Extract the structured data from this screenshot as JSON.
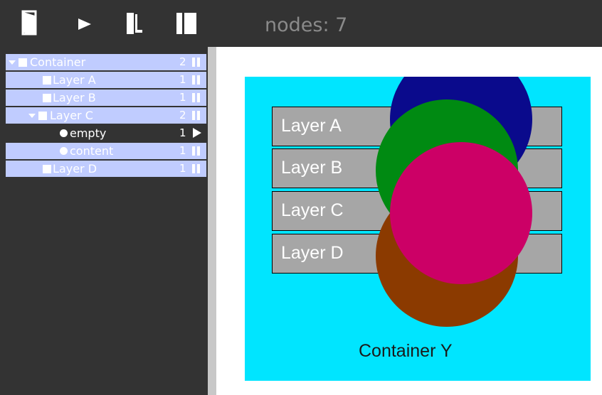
{
  "toolbar": {
    "nodes_label": "nodes: 7",
    "buttons": [
      {
        "icon": "open-door-icon"
      },
      {
        "icon": "play-icon"
      },
      {
        "icon": "export-icon"
      },
      {
        "icon": "split-panel-icon"
      }
    ]
  },
  "tree": {
    "rows": [
      {
        "label": "Container",
        "count": "2",
        "marker": "square",
        "expanded": true,
        "state": "pause"
      },
      {
        "label": "Layer A",
        "count": "1",
        "marker": "square",
        "state": "pause"
      },
      {
        "label": "Layer B",
        "count": "1",
        "marker": "square",
        "state": "pause"
      },
      {
        "label": "Layer C",
        "count": "2",
        "marker": "square",
        "expanded": true,
        "state": "pause"
      },
      {
        "label": "empty",
        "count": "1",
        "marker": "dot",
        "state": "play",
        "selected": true
      },
      {
        "label": "content",
        "count": "1",
        "marker": "dot",
        "state": "pause"
      },
      {
        "label": "Layer D",
        "count": "1",
        "marker": "square",
        "state": "pause"
      }
    ]
  },
  "canvas": {
    "container_label": "Container Y",
    "container_color": "#00e5ff",
    "layers": [
      {
        "label": "Layer A"
      },
      {
        "label": "Layer B"
      },
      {
        "label": "Layer C"
      },
      {
        "label": "Layer D"
      }
    ],
    "circle_colors": {
      "navy": "#0a0a8c",
      "green": "#008a12",
      "brown": "#8b3a00",
      "magenta": "#cc0066"
    }
  }
}
